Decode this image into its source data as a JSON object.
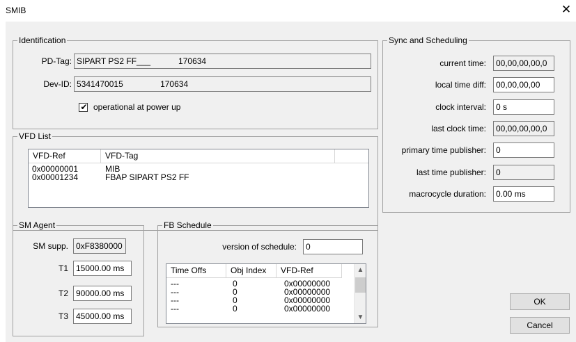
{
  "window": {
    "title": "SMIB",
    "close_glyph": "✕"
  },
  "identification": {
    "label": "Identification",
    "pd_tag_label": "PD-Tag:",
    "pd_tag_value": "SIPART PS2 FF___            170634",
    "dev_id_label": "Dev-ID:",
    "dev_id_value": "5341470015                170634",
    "checkbox_label": "operational at power up",
    "checkbox_checked": true
  },
  "vfd_list": {
    "label": "VFD List",
    "columns": [
      "VFD-Ref",
      "VFD-Tag"
    ],
    "rows": [
      {
        "ref": "0x00000001",
        "tag": "MIB"
      },
      {
        "ref": "0x00001234",
        "tag": "FBAP SIPART PS2 FF"
      }
    ]
  },
  "sync": {
    "label": "Sync and Scheduling",
    "current_time_label": "current time:",
    "current_time_value": "00,00,00,00,0",
    "local_time_diff_label": "local time diff:",
    "local_time_diff_value": "00,00,00,00",
    "clock_interval_label": "clock interval:",
    "clock_interval_value": "0 s",
    "last_clock_time_label": "last clock time:",
    "last_clock_time_value": "00,00,00,00,0",
    "primary_publisher_label": "primary time publisher:",
    "primary_publisher_value": "0",
    "last_publisher_label": "last time publisher:",
    "last_publisher_value": "0",
    "macrocycle_label": "macrocycle duration:",
    "macrocycle_value": "0.00 ms"
  },
  "sm_agent": {
    "label": "SM Agent",
    "sm_supp_label": "SM supp.",
    "sm_supp_value": "0xF8380000",
    "t1_label": "T1",
    "t1_value": "15000.00 ms",
    "t2_label": "T2",
    "t2_value": "90000.00 ms",
    "t3_label": "T3",
    "t3_value": "45000.00 ms"
  },
  "fb_schedule": {
    "label": "FB Schedule",
    "version_label": "version of schedule:",
    "version_value": "0",
    "columns": [
      "Time Offs",
      "Obj Index",
      "VFD-Ref"
    ],
    "rows": [
      {
        "time_offs": "---",
        "obj_index": "0",
        "vfd_ref": "0x00000000"
      },
      {
        "time_offs": "---",
        "obj_index": "0",
        "vfd_ref": "0x00000000"
      },
      {
        "time_offs": "---",
        "obj_index": "0",
        "vfd_ref": "0x00000000"
      },
      {
        "time_offs": "---",
        "obj_index": "0",
        "vfd_ref": "0x00000000"
      }
    ]
  },
  "buttons": {
    "ok": "OK",
    "cancel": "Cancel"
  },
  "icons": {
    "check": "✔",
    "scroll_up": "▲",
    "scroll_down": "▼"
  }
}
